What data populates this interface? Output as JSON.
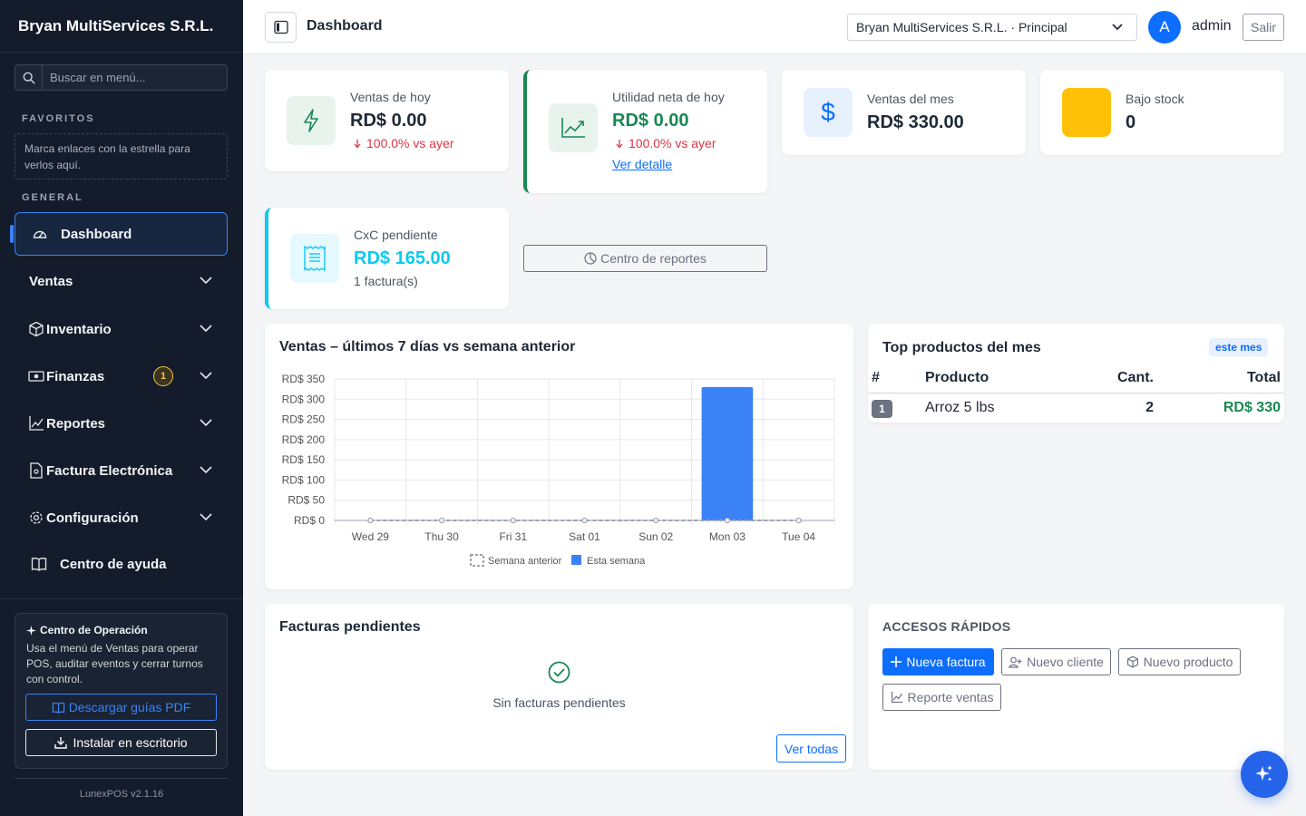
{
  "sidebar": {
    "brand": "Bryan MultiServices S.R.L.",
    "search_placeholder": "Buscar en menú...",
    "favorites_title": "FAVORITOS",
    "favorites_hint": "Marca enlaces con la estrella para verlos aquí.",
    "general_title": "GENERAL",
    "items": [
      {
        "label": "Dashboard",
        "icon": "gauge-icon",
        "active": true
      },
      {
        "label": "Ventas",
        "icon": "none",
        "expandable": true
      },
      {
        "label": "Inventario",
        "icon": "box-icon",
        "expandable": true
      },
      {
        "label": "Finanzas",
        "icon": "cash-icon",
        "expandable": true,
        "badge": "1"
      },
      {
        "label": "Reportes",
        "icon": "chart-line-icon",
        "expandable": true
      },
      {
        "label": "Factura Electrónica",
        "icon": "document-icon",
        "expandable": true
      },
      {
        "label": "Configuración",
        "icon": "gear-icon",
        "expandable": true
      },
      {
        "label": "Centro de ayuda",
        "icon": "book-icon"
      }
    ],
    "ops_card": {
      "title": "Centro de Operación",
      "text": "Usa el menú de Ventas para operar POS, auditar eventos y cerrar turnos con control.",
      "download_label": "Descargar guías PDF",
      "install_label": "Instalar en escritorio"
    },
    "version": "LunexPOS v2.1.16"
  },
  "topbar": {
    "title": "Dashboard",
    "branch": "Bryan MultiServices S.R.L. · Principal",
    "avatar_initial": "A",
    "user": "admin",
    "logout_label": "Salir"
  },
  "kpis": {
    "sales_today": {
      "label": "Ventas de hoy",
      "value": "RD$ 0.00",
      "delta": "100.0% vs ayer"
    },
    "profit_today": {
      "label": "Utilidad neta de hoy",
      "value": "RD$ 0.00",
      "delta": "100.0% vs ayer",
      "link": "Ver detalle"
    },
    "sales_month": {
      "label": "Ventas del mes",
      "value": "RD$ 330.00"
    },
    "low_stock": {
      "label": "Bajo stock",
      "value": "0"
    },
    "receivables": {
      "label": "CxC pendiente",
      "value": "RD$ 165.00",
      "sub": "1 factura(s)"
    }
  },
  "reports_button": "Centro de reportes",
  "sales_chart": {
    "title": "Ventas – últimos 7 días vs semana anterior",
    "chart_data": {
      "type": "bar",
      "categories": [
        "Wed 29",
        "Thu 30",
        "Fri 31",
        "Sat 01",
        "Sun 02",
        "Mon 03",
        "Tue 04"
      ],
      "series": [
        {
          "name": "Semana anterior",
          "type": "line",
          "values": [
            0,
            0,
            0,
            0,
            0,
            0,
            0
          ],
          "color": "#9ca3af"
        },
        {
          "name": "Esta semana",
          "type": "bar",
          "values": [
            0,
            0,
            0,
            0,
            0,
            330,
            0
          ],
          "color": "#3b82f6"
        }
      ],
      "y_ticks": [
        "RD$ 0",
        "RD$ 50",
        "RD$ 100",
        "RD$ 150",
        "RD$ 200",
        "RD$ 250",
        "RD$ 300",
        "RD$ 350"
      ],
      "ylim": [
        0,
        350
      ],
      "grid": true,
      "legend": "bottom"
    }
  },
  "top_products": {
    "title": "Top productos del mes",
    "pill": "este mes",
    "headers": {
      "rank": "#",
      "product": "Producto",
      "qty": "Cant.",
      "total": "Total"
    },
    "rows": [
      {
        "rank": "1",
        "product": "Arroz 5 lbs",
        "qty": "2",
        "total": "RD$ 330"
      }
    ]
  },
  "pending_invoices": {
    "title": "Facturas pendientes",
    "empty_text": "Sin facturas pendientes",
    "view_all": "Ver todas"
  },
  "quick_access": {
    "title": "ACCESOS RÁPIDOS",
    "new_invoice": "Nueva factura",
    "new_client": "Nuevo cliente",
    "new_product": "Nuevo producto",
    "sales_report": "Reporte ventas"
  },
  "colors": {
    "accent": "#0d6efd",
    "success": "#198754",
    "danger": "#dc3545",
    "info": "#0dcaf0",
    "warning": "#ffc107",
    "sidebar_bg": "#141c2b"
  }
}
